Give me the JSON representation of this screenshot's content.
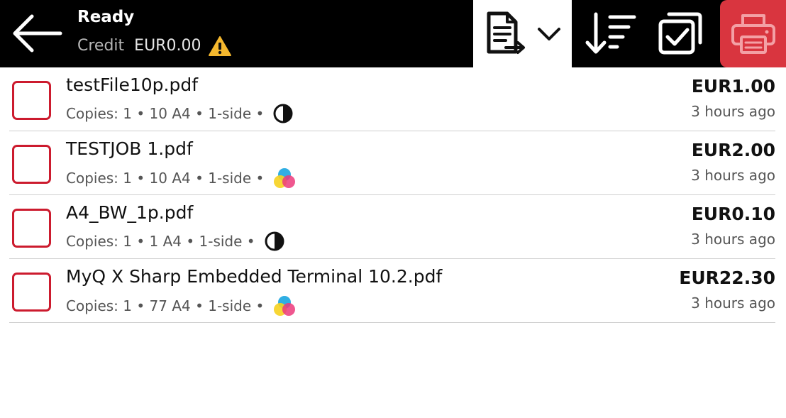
{
  "header": {
    "back_icon": "arrow-left-icon",
    "status_title": "Ready",
    "credit_label": "Credit",
    "credit_value": "EUR0.00",
    "warning_icon": "warning-icon",
    "doc_menu_icon": "document-export-icon",
    "doc_menu_dropdown_icon": "chevron-down-icon",
    "sort_icon": "sort-icon",
    "select_all_icon": "select-all-icon",
    "print_icon": "printer-icon"
  },
  "colors": {
    "topbar": "#000000",
    "print_button": "#d9353f",
    "checkbox_border": "#cc1b2e",
    "warning": "#f5b82e"
  },
  "jobs": [
    {
      "name": "testFile10p.pdf",
      "copies": "Copies: 1",
      "pages": "10 A4",
      "sides": "1-side",
      "color_mode": "bw",
      "color_icon": "bw-icon",
      "price": "EUR1.00",
      "time": "3 hours ago"
    },
    {
      "name": "TESTJOB 1.pdf",
      "copies": "Copies: 1",
      "pages": "10 A4",
      "sides": "1-side",
      "color_mode": "color",
      "color_icon": "color-icon",
      "price": "EUR2.00",
      "time": "3 hours ago"
    },
    {
      "name": "A4_BW_1p.pdf",
      "copies": "Copies: 1",
      "pages": "1 A4",
      "sides": "1-side",
      "color_mode": "bw",
      "color_icon": "bw-icon",
      "price": "EUR0.10",
      "time": "3 hours ago"
    },
    {
      "name": "MyQ X Sharp Embedded Terminal 10.2.pdf",
      "copies": "Copies: 1",
      "pages": "77 A4",
      "sides": "1-side",
      "color_mode": "color",
      "color_icon": "color-icon",
      "price": "EUR22.30",
      "time": "3 hours ago"
    }
  ]
}
